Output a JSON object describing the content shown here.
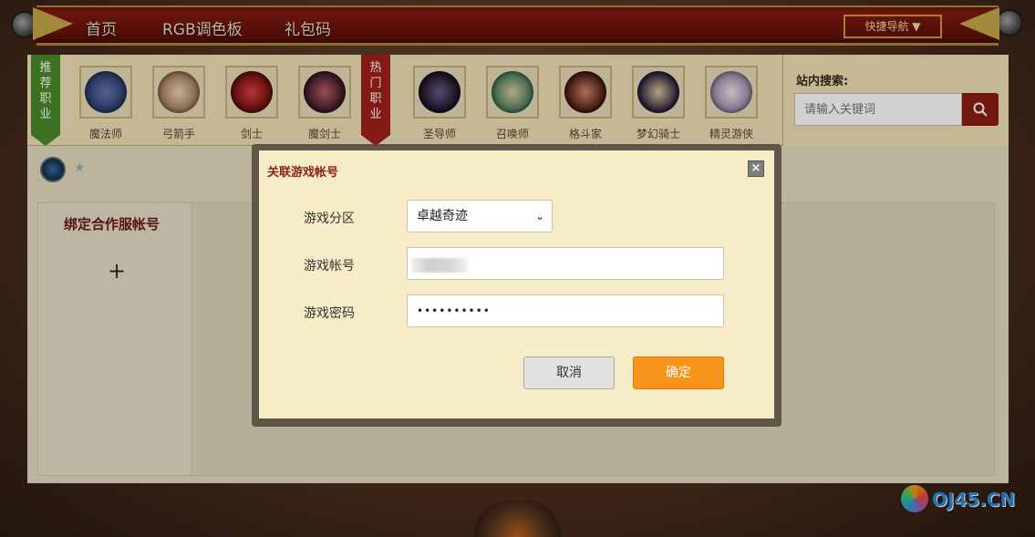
{
  "nav": {
    "items": [
      "首页",
      "RGB调色板",
      "礼包码"
    ],
    "quick_nav": "快捷导航 ▼"
  },
  "recommended_ribbon": "推荐职业",
  "hot_ribbon": "热门职业",
  "classes_recommended": [
    {
      "name": "魔法师",
      "color": "#2c3d6e"
    },
    {
      "name": "弓箭手",
      "color": "#c9a07a"
    },
    {
      "name": "剑士",
      "color": "#8a1616"
    },
    {
      "name": "魔剑士",
      "color": "#6a2a3a"
    }
  ],
  "classes_hot": [
    {
      "name": "圣导师",
      "color": "#2a2238"
    },
    {
      "name": "召唤师",
      "color": "#5a8a6a"
    },
    {
      "name": "格斗家",
      "color": "#5a1a12"
    },
    {
      "name": "梦幻骑士",
      "color": "#3a3050"
    },
    {
      "name": "精灵游侠",
      "color": "#c8b6c8"
    }
  ],
  "search": {
    "title": "站内搜索:",
    "placeholder": "请输入关键词"
  },
  "sidebar": {
    "title": "绑定合作服帐号",
    "add": "+"
  },
  "modal": {
    "title": "关联游戏帐号",
    "close": "×",
    "zone_label": "游戏分区",
    "zone_value": "卓越奇迹",
    "account_label": "游戏帐号",
    "password_label": "游戏密码",
    "password_value": "••••••••••",
    "cancel": "取消",
    "confirm": "确定"
  },
  "watermark": "OJ45.CN"
}
